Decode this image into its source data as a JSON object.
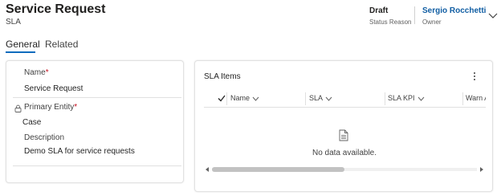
{
  "header": {
    "title": "Service Request",
    "entity": "SLA",
    "status": {
      "value": "Draft",
      "label": "Status Reason"
    },
    "owner": {
      "value": "Sergio Rocchetti",
      "label": "Owner"
    }
  },
  "tabs": [
    {
      "label": "General",
      "selected": true
    },
    {
      "label": "Related",
      "selected": false
    }
  ],
  "form": {
    "name": {
      "label": "Name",
      "required": "*",
      "value": "Service Request"
    },
    "primary_entity": {
      "label": "Primary Entity",
      "required": "*",
      "value": "Case",
      "locked_icon": "lock-icon"
    },
    "description": {
      "label": "Description",
      "value": "Demo SLA for service requests"
    }
  },
  "sla_items": {
    "title": "SLA Items",
    "columns": [
      "Name",
      "SLA",
      "SLA KPI",
      "Warn A"
    ],
    "empty_text": "No data available.",
    "scroll_position": 0.0
  },
  "colors": {
    "accent": "#0f6cbd",
    "owner_link": "#115ea3",
    "required": "#c50f1f"
  }
}
